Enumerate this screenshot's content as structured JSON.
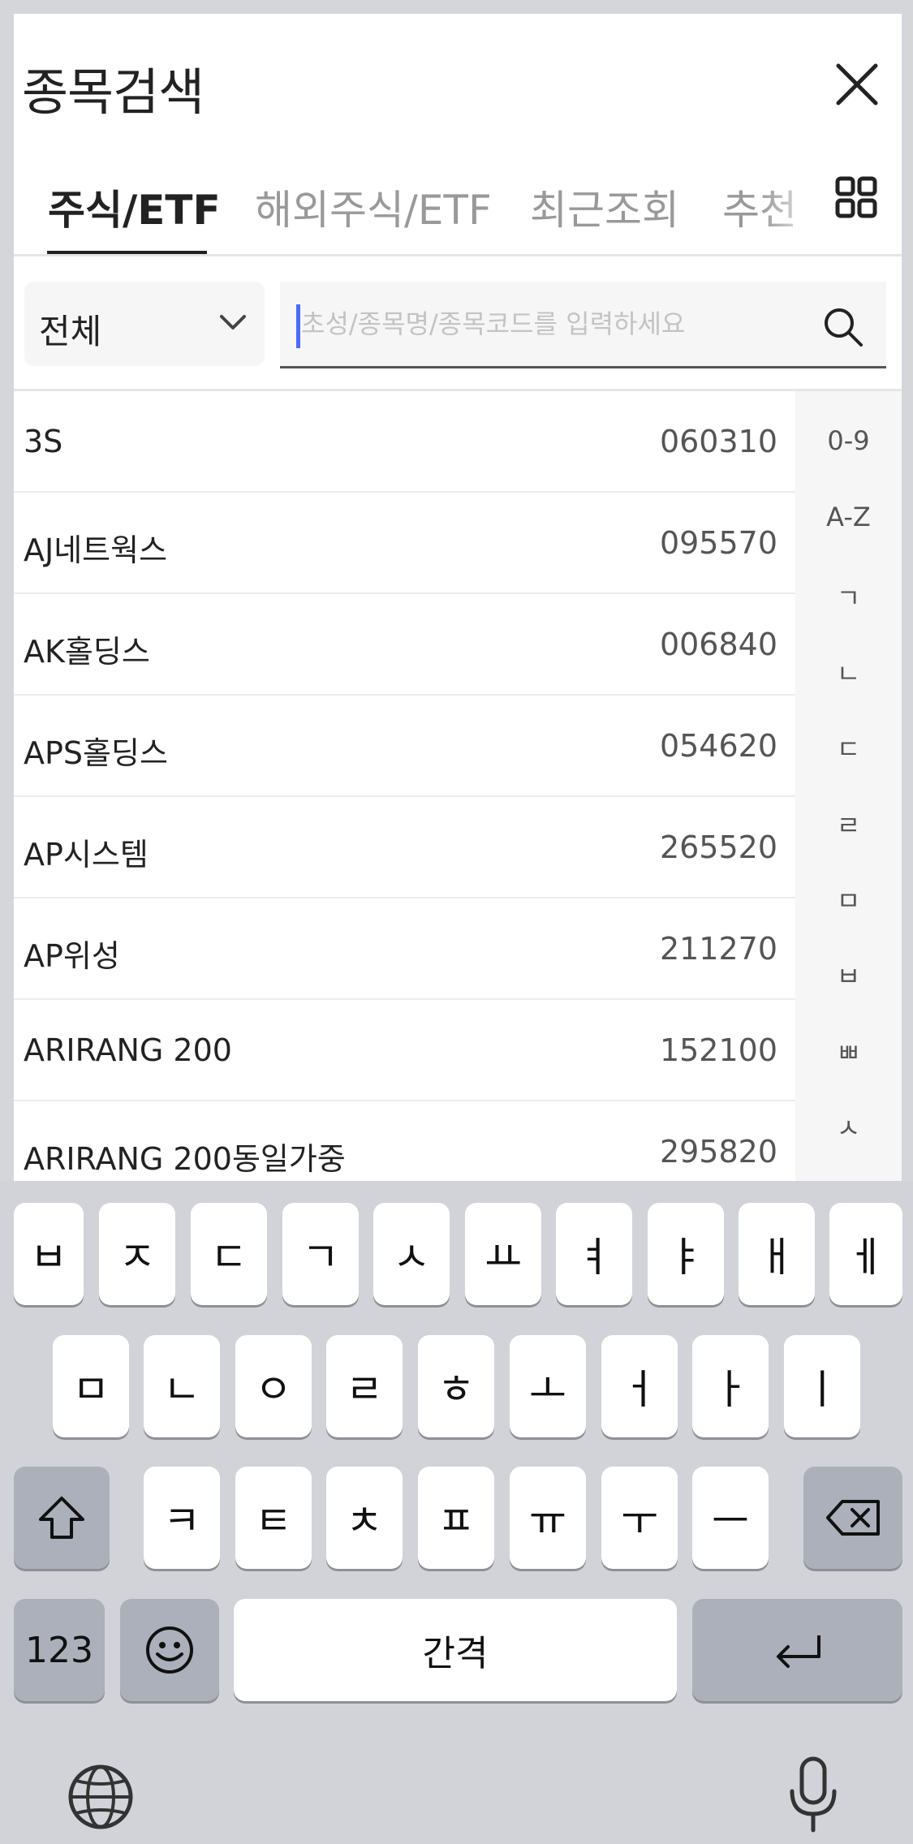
{
  "header": {
    "title": "종목검색"
  },
  "tabs": [
    {
      "label": "주식/ETF",
      "active": true
    },
    {
      "label": "해외주식/ETF",
      "active": false
    },
    {
      "label": "최근조회",
      "active": false
    },
    {
      "label": "추천",
      "active": false
    }
  ],
  "filter": {
    "selected": "전체"
  },
  "search": {
    "placeholder": "초성/종목명/종목코드를 입력하세요",
    "value": ""
  },
  "stocks": [
    {
      "name": "3S",
      "code": "060310"
    },
    {
      "name": "AJ네트웍스",
      "code": "095570"
    },
    {
      "name": "AK홀딩스",
      "code": "006840"
    },
    {
      "name": "APS홀딩스",
      "code": "054620"
    },
    {
      "name": "AP시스템",
      "code": "265520"
    },
    {
      "name": "AP위성",
      "code": "211270"
    },
    {
      "name": "ARIRANG 200",
      "code": "152100"
    },
    {
      "name": "ARIRANG 200동일가중",
      "code": "295820"
    }
  ],
  "index_bar": [
    "0-9",
    "A-Z",
    "ㄱ",
    "ㄴ",
    "ㄷ",
    "ㄹ",
    "ㅁ",
    "ㅂ",
    "ㅃ",
    "ㅅ"
  ],
  "keyboard": {
    "row1": [
      "ㅂ",
      "ㅈ",
      "ㄷ",
      "ㄱ",
      "ㅅ",
      "ㅛ",
      "ㅕ",
      "ㅑ",
      "ㅐ",
      "ㅔ"
    ],
    "row2": [
      "ㅁ",
      "ㄴ",
      "ㅇ",
      "ㄹ",
      "ㅎ",
      "ㅗ",
      "ㅓ",
      "ㅏ",
      "ㅣ"
    ],
    "row3": [
      "ㅋ",
      "ㅌ",
      "ㅊ",
      "ㅍ",
      "ㅠ",
      "ㅜ",
      "ㅡ"
    ],
    "numbers_label": "123",
    "space_label": "간격"
  },
  "colors": {
    "accent": "#4a6cf7",
    "active_tab": "#222222",
    "inactive_tab": "#999999",
    "keyboard_bg": "#d1d3d9",
    "dark_key": "#abb0ba"
  }
}
